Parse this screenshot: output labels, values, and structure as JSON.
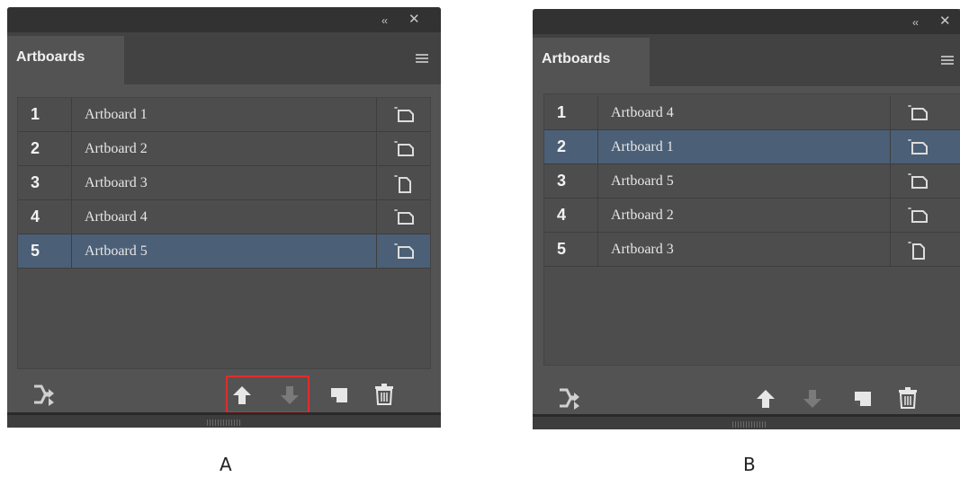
{
  "colors": {
    "panel_bg": "#535353",
    "titlebar_bg": "#323232",
    "selection": "#4b5f77",
    "highlight_border": "#e32b2b"
  },
  "panel_a": {
    "collapse_label": "‹‹",
    "close_label": "✕",
    "tab_label": "Artboards",
    "rows": [
      {
        "num": "1",
        "name": "Artboard 1",
        "orientation": "landscape",
        "selected": false
      },
      {
        "num": "2",
        "name": "Artboard 2",
        "orientation": "landscape",
        "selected": false
      },
      {
        "num": "3",
        "name": "Artboard 3",
        "orientation": "portrait",
        "selected": false
      },
      {
        "num": "4",
        "name": "Artboard 4",
        "orientation": "landscape",
        "selected": false
      },
      {
        "num": "5",
        "name": "Artboard 5",
        "orientation": "landscape",
        "selected": true
      }
    ],
    "caption": "A"
  },
  "panel_b": {
    "collapse_label": "‹‹",
    "close_label": "✕",
    "tab_label": "Artboards",
    "rows": [
      {
        "num": "1",
        "name": "Artboard 4",
        "orientation": "landscape",
        "selected": false
      },
      {
        "num": "2",
        "name": "Artboard 1",
        "orientation": "landscape",
        "selected": true
      },
      {
        "num": "3",
        "name": "Artboard 5",
        "orientation": "landscape",
        "selected": false
      },
      {
        "num": "4",
        "name": "Artboard 2",
        "orientation": "landscape",
        "selected": false
      },
      {
        "num": "5",
        "name": "Artboard 3",
        "orientation": "portrait",
        "selected": false
      }
    ],
    "caption": "B"
  },
  "icons": {
    "rearrange": "rearrange-artboards-icon",
    "move_up": "move-up-icon",
    "move_down": "move-down-icon",
    "new_artboard": "new-artboard-icon",
    "delete": "trash-icon",
    "orientation": "artboard-orientation-icon"
  }
}
